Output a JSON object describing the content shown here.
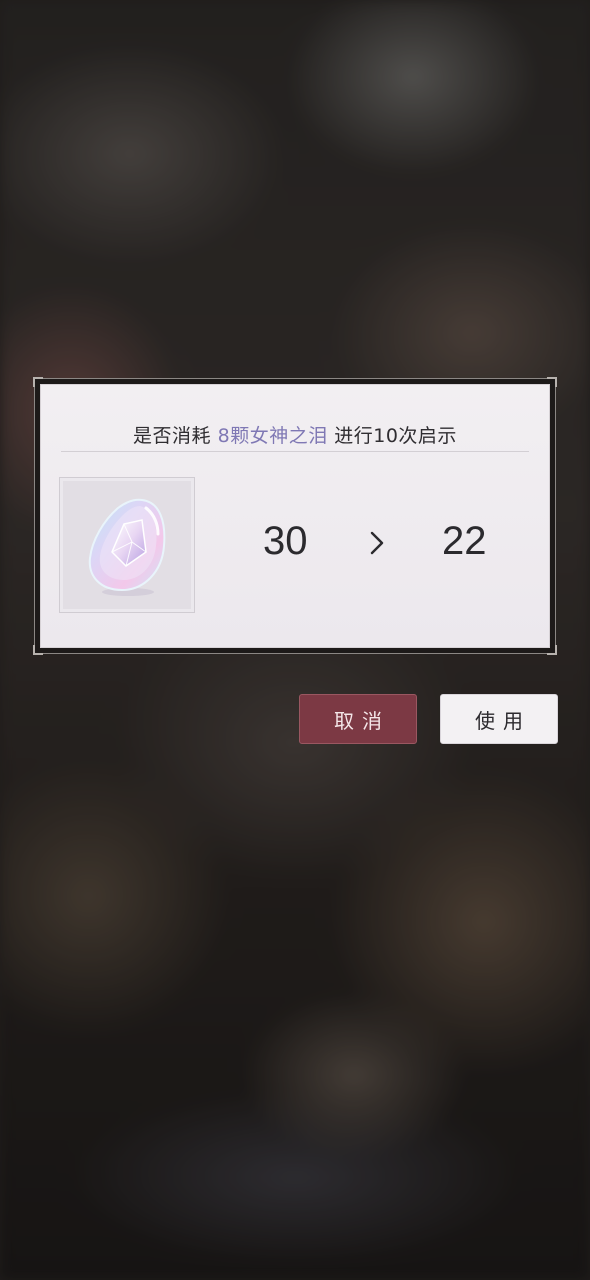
{
  "dialog": {
    "prompt_prefix": "是否消耗",
    "prompt_item": "8颗女神之泪",
    "prompt_suffix": "进行10次启示",
    "item_icon": "goddess-tear-gem-icon",
    "count_before": "30",
    "count_after": "22",
    "arrow_icon": "chevron-right-icon"
  },
  "buttons": {
    "cancel_label": "取消",
    "use_label": "使用"
  },
  "colors": {
    "highlight": "#7f78b4",
    "cancel_bg": "#7c3944",
    "use_bg": "#f3f1f3"
  }
}
